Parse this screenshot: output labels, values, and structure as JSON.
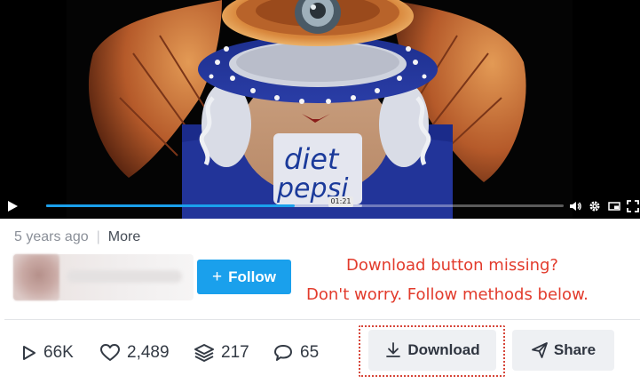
{
  "player": {
    "time_tooltip": "01:21",
    "progress_played": 0.48,
    "progress_buffered": 0.61,
    "accent": "#1aa0ec",
    "icons": [
      "play-icon",
      "volume-icon",
      "settings-icon",
      "pip-icon",
      "fullscreen-icon"
    ]
  },
  "video_frame": {
    "can_text_line1": "diet",
    "can_text_line2": "pepsi"
  },
  "meta": {
    "posted": "5 years ago",
    "separator": "|",
    "more_label": "More"
  },
  "author": {
    "follow_label": "Follow",
    "follow_plus": "+"
  },
  "notes": {
    "line1": "Download button missing?",
    "line2": "Don't worry. Follow methods below.",
    "color": "#e23b2c"
  },
  "stats": {
    "plays": "66K",
    "likes": "2,489",
    "collections": "217",
    "comments": "65"
  },
  "actions": {
    "download_label": "Download",
    "share_label": "Share"
  }
}
